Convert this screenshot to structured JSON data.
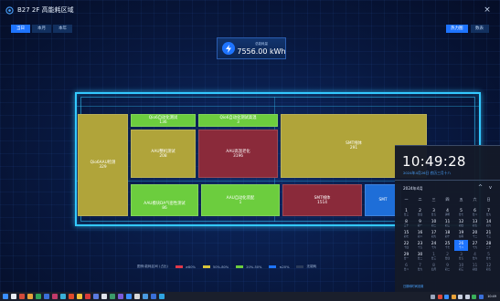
{
  "window": {
    "title": "B27 2F 高能耗区域",
    "close": "×"
  },
  "mode_tabs": [
    {
      "label": "当日",
      "active": true
    },
    {
      "label": "本月",
      "active": false
    },
    {
      "label": "本年",
      "active": false
    }
  ],
  "view_tabs": [
    {
      "label": "热力图",
      "active": true
    },
    {
      "label": "数表",
      "active": false
    }
  ],
  "kpi": {
    "label": "总能耗量",
    "value": "7556.00 kWh",
    "icon": "lightning-icon"
  },
  "zones": [
    {
      "name": "Qio6AAU检测",
      "value": "329",
      "color": "yellow"
    },
    {
      "name": "Qio6自动化测试",
      "value": "136",
      "color": "green"
    },
    {
      "name": "Qio6自动化测试高温",
      "value": "3",
      "color": "green"
    },
    {
      "name": "AAU整机测试",
      "value": "208",
      "color": "yellow"
    },
    {
      "name": "AAU高温老化",
      "value": "3196",
      "color": "red"
    },
    {
      "name": "SMT线体",
      "value": "291",
      "color": "yellow"
    },
    {
      "name": "AAU模块DA气密性测试",
      "value": "86",
      "color": "green"
    },
    {
      "name": "AAU自动化装配",
      "value": "1",
      "color": "green"
    },
    {
      "name": "SMT线体",
      "value": "1514",
      "color": "red"
    },
    {
      "name": "SMT",
      "value": "",
      "color": "blue"
    }
  ],
  "legend": {
    "title": "图例:能耗区间 (占比)",
    "items": [
      {
        "label": "≥80%",
        "color": "#e0384a"
      },
      {
        "label": "50%-80%",
        "color": "#d8c43a"
      },
      {
        "label": "20%-50%",
        "color": "#6ccd3e"
      },
      {
        "label": "≤20%",
        "color": "#1e74ff"
      },
      {
        "label": "无能耗",
        "color": "#2a3a5a"
      }
    ]
  },
  "clock": {
    "time": "10:49:28",
    "date": "2024年4月26日  农历三月十八",
    "month_label": "2024年4月",
    "nav_up": "^",
    "nav_down": "v",
    "weekdays": [
      "一",
      "二",
      "三",
      "四",
      "五",
      "六",
      "日"
    ],
    "weeks": [
      [
        [
          "1",
          "廿三"
        ],
        [
          "2",
          "廿四"
        ],
        [
          "3",
          "廿五"
        ],
        [
          "4",
          "清明"
        ],
        [
          "5",
          "廿七"
        ],
        [
          "6",
          "廿八"
        ],
        [
          "7",
          "廿九"
        ]
      ],
      [
        [
          "8",
          "三十"
        ],
        [
          "9",
          "初一"
        ],
        [
          "10",
          "初二"
        ],
        [
          "11",
          "初三"
        ],
        [
          "12",
          "初四"
        ],
        [
          "13",
          "初五"
        ],
        [
          "14",
          "初六"
        ]
      ],
      [
        [
          "15",
          "初七"
        ],
        [
          "16",
          "初八"
        ],
        [
          "17",
          "初九"
        ],
        [
          "18",
          "初十"
        ],
        [
          "19",
          "谷雨"
        ],
        [
          "20",
          "十二"
        ],
        [
          "21",
          "十三"
        ]
      ],
      [
        [
          "22",
          "十四"
        ],
        [
          "23",
          "十五"
        ],
        [
          "24",
          "十六"
        ],
        [
          "25",
          "十七"
        ],
        [
          "26",
          "十八"
        ],
        [
          "27",
          "十九"
        ],
        [
          "28",
          "二十"
        ]
      ],
      [
        [
          "29",
          "廿一"
        ],
        [
          "30",
          "廿二"
        ],
        [
          "1",
          "廿三"
        ],
        [
          "2",
          "廿四"
        ],
        [
          "3",
          "廿五"
        ],
        [
          "4",
          "廿六"
        ],
        [
          "5",
          "廿七"
        ]
      ],
      [
        [
          "6",
          "廿八"
        ],
        [
          "7",
          "廿九"
        ],
        [
          "8",
          "四月"
        ],
        [
          "9",
          "初二"
        ],
        [
          "10",
          "初三"
        ],
        [
          "11",
          "初四"
        ],
        [
          "12",
          "初五"
        ]
      ]
    ],
    "today": "26",
    "footer": "日期和时间设置"
  },
  "taskbar": {
    "tray_time": "10:49"
  },
  "colors": {
    "accent": "#1e74ff",
    "outline": "#33c9ff"
  }
}
